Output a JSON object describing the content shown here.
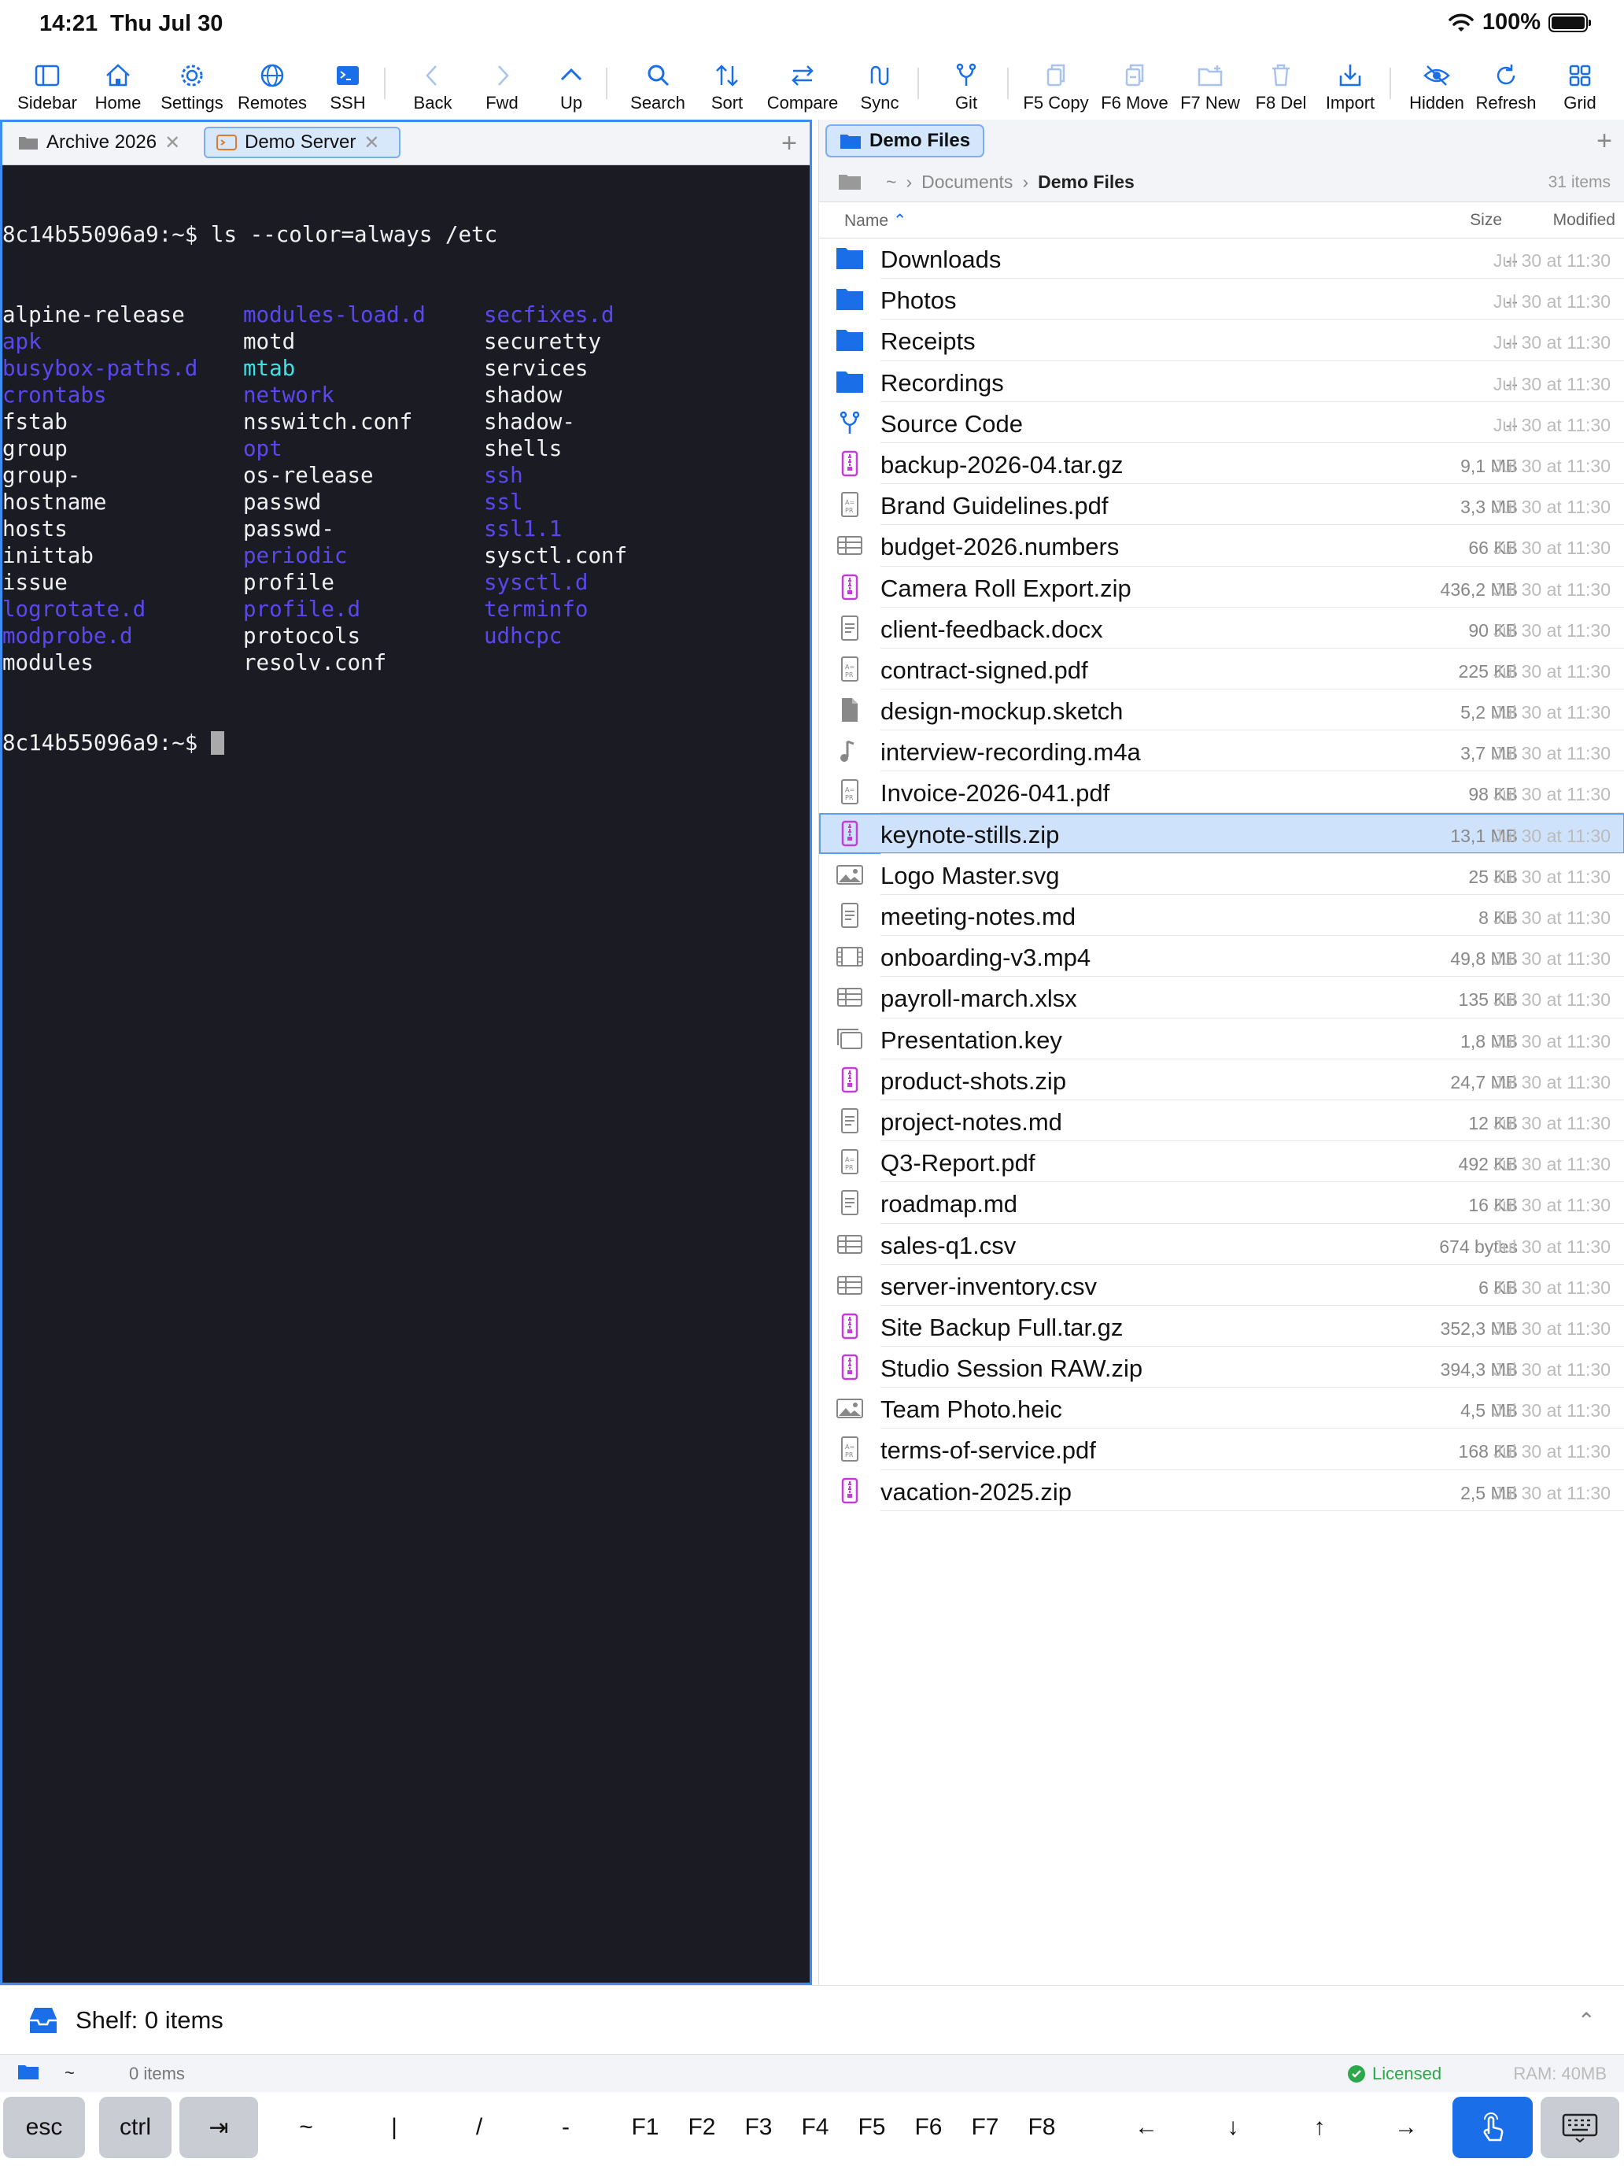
{
  "status": {
    "time": "14:21",
    "date": "Thu Jul 30",
    "battery": "100%"
  },
  "toolbar": [
    {
      "label": "Sidebar",
      "icon": "sidebar-icon"
    },
    {
      "label": "Home",
      "icon": "home-icon"
    },
    {
      "label": "Settings",
      "icon": "gear-icon"
    },
    {
      "label": "Remotes",
      "icon": "globe-icon"
    },
    {
      "label": "SSH",
      "icon": "terminal-icon"
    },
    {
      "label": "Back",
      "icon": "chevron-left-icon"
    },
    {
      "label": "Fwd",
      "icon": "chevron-right-icon"
    },
    {
      "label": "Up",
      "icon": "chevron-up-icon"
    },
    {
      "label": "Search",
      "icon": "search-icon"
    },
    {
      "label": "Sort",
      "icon": "sort-icon"
    },
    {
      "label": "Compare",
      "icon": "compare-icon"
    },
    {
      "label": "Sync",
      "icon": "sync-icon"
    },
    {
      "label": "Git",
      "icon": "git-branch-icon"
    },
    {
      "label": "F5 Copy",
      "icon": "copy-icon"
    },
    {
      "label": "F6 Move",
      "icon": "move-icon"
    },
    {
      "label": "F7 New",
      "icon": "new-folder-icon"
    },
    {
      "label": "F8 Del",
      "icon": "trash-icon"
    },
    {
      "label": "Import",
      "icon": "import-icon"
    },
    {
      "label": "Hidden",
      "icon": "eye-slash-icon"
    },
    {
      "label": "Refresh",
      "icon": "refresh-icon"
    },
    {
      "label": "Grid",
      "icon": "grid-icon"
    }
  ],
  "left_tabs": [
    {
      "label": "Archive 2026"
    },
    {
      "label": "Demo Server"
    }
  ],
  "terminal": {
    "prompt": "8c14b55096a9:~$",
    "command": " ls --color=always /etc",
    "rows": [
      [
        [
          "alpine-release",
          "w"
        ],
        [
          "modules-load.d",
          "b"
        ],
        [
          "secfixes.d",
          "b"
        ]
      ],
      [
        [
          "apk",
          "b"
        ],
        [
          "motd",
          "w"
        ],
        [
          "securetty",
          "w"
        ]
      ],
      [
        [
          "busybox-paths.d",
          "b"
        ],
        [
          "mtab",
          "c"
        ],
        [
          "services",
          "w"
        ]
      ],
      [
        [
          "crontabs",
          "b"
        ],
        [
          "network",
          "b"
        ],
        [
          "shadow",
          "w"
        ]
      ],
      [
        [
          "fstab",
          "w"
        ],
        [
          "nsswitch.conf",
          "w"
        ],
        [
          "shadow-",
          "w"
        ]
      ],
      [
        [
          "group",
          "w"
        ],
        [
          "opt",
          "b"
        ],
        [
          "shells",
          "w"
        ]
      ],
      [
        [
          "group-",
          "w"
        ],
        [
          "os-release",
          "w"
        ],
        [
          "ssh",
          "b"
        ]
      ],
      [
        [
          "hostname",
          "w"
        ],
        [
          "passwd",
          "w"
        ],
        [
          "ssl",
          "b"
        ]
      ],
      [
        [
          "hosts",
          "w"
        ],
        [
          "passwd-",
          "w"
        ],
        [
          "ssl1.1",
          "b"
        ]
      ],
      [
        [
          "inittab",
          "w"
        ],
        [
          "periodic",
          "b"
        ],
        [
          "sysctl.conf",
          "w"
        ]
      ],
      [
        [
          "issue",
          "w"
        ],
        [
          "profile",
          "w"
        ],
        [
          "sysctl.d",
          "b"
        ]
      ],
      [
        [
          "logrotate.d",
          "b"
        ],
        [
          "profile.d",
          "b"
        ],
        [
          "terminfo",
          "b"
        ]
      ],
      [
        [
          "modprobe.d",
          "b"
        ],
        [
          "protocols",
          "w"
        ],
        [
          "udhcpc",
          "b"
        ]
      ],
      [
        [
          "modules",
          "w"
        ],
        [
          "resolv.conf",
          "w"
        ],
        [
          "",
          ""
        ]
      ]
    ]
  },
  "right_tab": {
    "label": "Demo Files"
  },
  "breadcrumb": {
    "root": "~",
    "parent": "Documents",
    "current": "Demo Files",
    "count": "31 items"
  },
  "columns": {
    "name": "Name",
    "size": "Size",
    "modified": "Modified"
  },
  "files": [
    {
      "name": "Downloads",
      "size": "--",
      "modified": "Jul 30 at 11:30",
      "kind": "folder"
    },
    {
      "name": "Photos",
      "size": "--",
      "modified": "Jul 30 at 11:30",
      "kind": "folder"
    },
    {
      "name": "Receipts",
      "size": "--",
      "modified": "Jul 30 at 11:30",
      "kind": "folder"
    },
    {
      "name": "Recordings",
      "size": "--",
      "modified": "Jul 30 at 11:30",
      "kind": "folder"
    },
    {
      "name": "Source Code",
      "size": "--",
      "modified": "Jul 30 at 11:30",
      "kind": "git"
    },
    {
      "name": "backup-2026-04.tar.gz",
      "size": "9,1 MB",
      "modified": "Jul 30 at 11:30",
      "kind": "zip"
    },
    {
      "name": "Brand Guidelines.pdf",
      "size": "3,3 MB",
      "modified": "Jul 30 at 11:30",
      "kind": "pdf"
    },
    {
      "name": "budget-2026.numbers",
      "size": "66 KB",
      "modified": "Jul 30 at 11:30",
      "kind": "table"
    },
    {
      "name": "Camera Roll Export.zip",
      "size": "436,2 MB",
      "modified": "Jul 30 at 11:30",
      "kind": "zip"
    },
    {
      "name": "client-feedback.docx",
      "size": "90 KB",
      "modified": "Jul 30 at 11:30",
      "kind": "doc"
    },
    {
      "name": "contract-signed.pdf",
      "size": "225 KB",
      "modified": "Jul 30 at 11:30",
      "kind": "pdf"
    },
    {
      "name": "design-mockup.sketch",
      "size": "5,2 MB",
      "modified": "Jul 30 at 11:30",
      "kind": "file"
    },
    {
      "name": "interview-recording.m4a",
      "size": "3,7 MB",
      "modified": "Jul 30 at 11:30",
      "kind": "audio"
    },
    {
      "name": "Invoice-2026-041.pdf",
      "size": "98 KB",
      "modified": "Jul 30 at 11:30",
      "kind": "pdf"
    },
    {
      "name": "keynote-stills.zip",
      "size": "13,1 MB",
      "modified": "Jul 30 at 11:30",
      "kind": "zip",
      "selected": true
    },
    {
      "name": "Logo Master.svg",
      "size": "25 KB",
      "modified": "Jul 30 at 11:30",
      "kind": "image"
    },
    {
      "name": "meeting-notes.md",
      "size": "8 KB",
      "modified": "Jul 30 at 11:30",
      "kind": "doc"
    },
    {
      "name": "onboarding-v3.mp4",
      "size": "49,8 MB",
      "modified": "Jul 30 at 11:30",
      "kind": "video"
    },
    {
      "name": "payroll-march.xlsx",
      "size": "135 KB",
      "modified": "Jul 30 at 11:30",
      "kind": "table"
    },
    {
      "name": "Presentation.key",
      "size": "1,8 MB",
      "modified": "Jul 30 at 11:30",
      "kind": "slides"
    },
    {
      "name": "product-shots.zip",
      "size": "24,7 MB",
      "modified": "Jul 30 at 11:30",
      "kind": "zip"
    },
    {
      "name": "project-notes.md",
      "size": "12 KB",
      "modified": "Jul 30 at 11:30",
      "kind": "doc"
    },
    {
      "name": "Q3-Report.pdf",
      "size": "492 KB",
      "modified": "Jul 30 at 11:30",
      "kind": "pdf"
    },
    {
      "name": "roadmap.md",
      "size": "16 KB",
      "modified": "Jul 30 at 11:30",
      "kind": "doc"
    },
    {
      "name": "sales-q1.csv",
      "size": "674 bytes",
      "modified": "Jul 30 at 11:30",
      "kind": "table"
    },
    {
      "name": "server-inventory.csv",
      "size": "6 KB",
      "modified": "Jul 30 at 11:30",
      "kind": "table"
    },
    {
      "name": "Site Backup Full.tar.gz",
      "size": "352,3 MB",
      "modified": "Jul 30 at 11:30",
      "kind": "zip"
    },
    {
      "name": "Studio Session RAW.zip",
      "size": "394,3 MB",
      "modified": "Jul 30 at 11:30",
      "kind": "zip"
    },
    {
      "name": "Team Photo.heic",
      "size": "4,5 MB",
      "modified": "Jul 30 at 11:30",
      "kind": "image"
    },
    {
      "name": "terms-of-service.pdf",
      "size": "168 KB",
      "modified": "Jul 30 at 11:30",
      "kind": "pdf"
    },
    {
      "name": "vacation-2025.zip",
      "size": "2,5 MB",
      "modified": "Jul 30 at 11:30",
      "kind": "zip"
    }
  ],
  "shelf": {
    "title": "Shelf: 0 items"
  },
  "footer": {
    "path": "~",
    "items": "0 items",
    "license": "Licensed",
    "ram": "RAM: 40MB"
  },
  "keys": [
    {
      "label": "esc",
      "style": "gray"
    },
    {
      "label": "ctrl",
      "style": "gray"
    },
    {
      "label": "⇥",
      "style": "gray"
    },
    {
      "label": "~"
    },
    {
      "label": "|"
    },
    {
      "label": "/"
    },
    {
      "label": "-"
    },
    {
      "label": "F1"
    },
    {
      "label": "F2"
    },
    {
      "label": "F3"
    },
    {
      "label": "F4"
    },
    {
      "label": "F5"
    },
    {
      "label": "F6"
    },
    {
      "label": "F7"
    },
    {
      "label": "F8"
    },
    {
      "label": "←"
    },
    {
      "label": "↓"
    },
    {
      "label": "↑"
    },
    {
      "label": "→"
    },
    {
      "label": "",
      "style": "blue",
      "icon": "touch-icon"
    },
    {
      "label": "",
      "style": "gray",
      "icon": "keyboard-icon"
    }
  ]
}
